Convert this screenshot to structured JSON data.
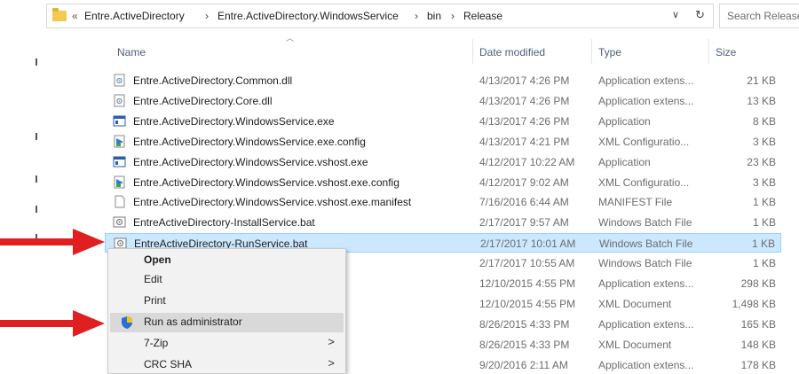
{
  "address_bar": {
    "overflow": "«",
    "crumbs": [
      "Entre.ActiveDirectory",
      "Entre.ActiveDirectory.WindowsService",
      "bin",
      "Release"
    ],
    "separator": "›",
    "dropdown": "∨",
    "refresh": "↻"
  },
  "search": {
    "placeholder": "Search Release"
  },
  "columns": {
    "name": "Name",
    "date": "Date modified",
    "type": "Type",
    "size": "Size"
  },
  "files": [
    {
      "name": "Entre.ActiveDirectory.Common.dll",
      "date": "4/13/2017 4:26 PM",
      "type": "Application extens...",
      "size": "21 KB",
      "icon": "dll-icon"
    },
    {
      "name": "Entre.ActiveDirectory.Core.dll",
      "date": "4/13/2017 4:26 PM",
      "type": "Application extens...",
      "size": "13 KB",
      "icon": "dll-icon"
    },
    {
      "name": "Entre.ActiveDirectory.WindowsService.exe",
      "date": "4/13/2017 4:26 PM",
      "type": "Application",
      "size": "8 KB",
      "icon": "exe-icon"
    },
    {
      "name": "Entre.ActiveDirectory.WindowsService.exe.config",
      "date": "4/13/2017 4:21 PM",
      "type": "XML Configuratio...",
      "size": "3 KB",
      "icon": "config-icon"
    },
    {
      "name": "Entre.ActiveDirectory.WindowsService.vshost.exe",
      "date": "4/12/2017 10:22 AM",
      "type": "Application",
      "size": "23 KB",
      "icon": "exe-icon"
    },
    {
      "name": "Entre.ActiveDirectory.WindowsService.vshost.exe.config",
      "date": "4/12/2017 9:02 AM",
      "type": "XML Configuratio...",
      "size": "3 KB",
      "icon": "config-icon"
    },
    {
      "name": "Entre.ActiveDirectory.WindowsService.vshost.exe.manifest",
      "date": "7/16/2016 6:44 AM",
      "type": "MANIFEST File",
      "size": "1 KB",
      "icon": "blank-file-icon"
    },
    {
      "name": "EntreActiveDirectory-InstallService.bat",
      "date": "2/17/2017 9:57 AM",
      "type": "Windows Batch File",
      "size": "1 KB",
      "icon": "bat-icon"
    },
    {
      "name": "EntreActiveDirectory-RunService.bat",
      "date": "2/17/2017 10:01 AM",
      "type": "Windows Batch File",
      "size": "1 KB",
      "icon": "bat-icon"
    },
    {
      "name": "",
      "date": "2/17/2017 10:55 AM",
      "type": "Windows Batch File",
      "size": "1 KB",
      "icon": ""
    },
    {
      "name": "",
      "date": "12/10/2015 4:55 PM",
      "type": "Application extens...",
      "size": "298 KB",
      "icon": ""
    },
    {
      "name": "",
      "date": "12/10/2015 4:55 PM",
      "type": "XML Document",
      "size": "1,498 KB",
      "icon": ""
    },
    {
      "name": "",
      "date": "8/26/2015 4:33 PM",
      "type": "Application extens...",
      "size": "165 KB",
      "icon": ""
    },
    {
      "name": "",
      "date": "8/26/2015 4:33 PM",
      "type": "XML Document",
      "size": "148 KB",
      "icon": ""
    },
    {
      "name": "",
      "date": "9/20/2016 2:11 AM",
      "type": "Application extens...",
      "size": "178 KB",
      "icon": ""
    }
  ],
  "context_menu": {
    "items": [
      {
        "label": "Open",
        "bold": true,
        "submenu": false,
        "icon": ""
      },
      {
        "label": "Edit",
        "bold": false,
        "submenu": false,
        "icon": ""
      },
      {
        "label": "Print",
        "bold": false,
        "submenu": false,
        "icon": ""
      },
      {
        "label": "Run as administrator",
        "bold": false,
        "submenu": false,
        "icon": "uac-shield-icon",
        "highlighted": true
      },
      {
        "label": "7-Zip",
        "bold": false,
        "submenu": true,
        "icon": ""
      },
      {
        "label": "CRC SHA",
        "bold": false,
        "submenu": true,
        "icon": ""
      }
    ],
    "submenu_arrow": ">"
  },
  "colors": {
    "selection_bg": "#cce8ff",
    "selection_border": "#99d1ff",
    "menu_bg": "#f2f2f2",
    "menu_highlight": "#d9d9d9",
    "annotation_arrow": "#e02020",
    "header_text": "#4c607a"
  }
}
